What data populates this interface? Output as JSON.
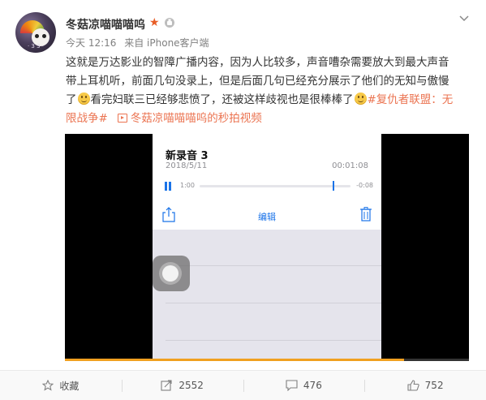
{
  "post": {
    "author": "冬菇凉喵喵喵呜",
    "avatar_caption": "· 3 3 ·",
    "time": "今天 12:16",
    "source": "来自 iPhone客户端",
    "content_lines": [
      "这就是万达影业的智障广播内容，因为人比较多，声音嘈杂需要放大到最大声音",
      "带上耳机听，前面几句没录上，但是后面几句已经充分展示了他们的无知与傲慢",
      "了"
    ],
    "content_after_emoji_1": "看完妇联三已经够悲愤了，还被这样歧视也是很棒棒了",
    "hashtag_part1": "#复仇者联盟：无",
    "hashtag_part2": "限战争#",
    "video_link": "冬菇凉喵喵喵呜的秒拍视频"
  },
  "video": {
    "progress_fraction": 0.84,
    "recording": {
      "title": "新录音 3",
      "date": "2018/5/11",
      "duration": "00:01:08",
      "elapsed": "1:00",
      "remaining": "-0:08",
      "playhead_fraction": 0.88,
      "edit_label": "编辑"
    }
  },
  "actions": {
    "favorite_label": "收藏",
    "forward_count": "2552",
    "comment_count": "476",
    "like_count": "752"
  },
  "colors": {
    "link": "#eb7350",
    "ios_blue": "#1a73e8",
    "star": "#e85d26",
    "progress": "#f0a020"
  },
  "icons": [
    "star-icon",
    "level-icon",
    "chevron-down-icon",
    "smile-emoji-icon",
    "film-icon",
    "pause-icon",
    "share-icon",
    "trash-icon",
    "favorite-star-icon",
    "forward-icon",
    "comment-icon",
    "like-icon"
  ]
}
